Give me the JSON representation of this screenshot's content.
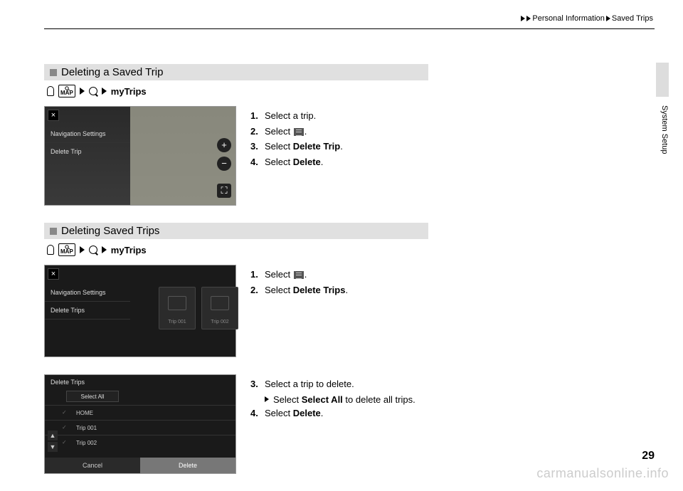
{
  "breadcrumb": {
    "part1": "Personal Information",
    "part2": "Saved Trips"
  },
  "side_tab": "System Setup",
  "page_number": "29",
  "watermark": "carmanualsonline.info",
  "nav": {
    "map_label": "MAP",
    "mytrips": "myTrips"
  },
  "section1": {
    "heading": "Deleting a Saved Trip",
    "screenshot": {
      "menu1": "Navigation Settings",
      "menu2": "Delete Trip"
    },
    "steps": {
      "s1": "Select a trip.",
      "s2a": "Select ",
      "s2b": ".",
      "s3a": "Select ",
      "s3b": "Delete Trip",
      "s3c": ".",
      "s4a": "Select ",
      "s4b": "Delete",
      "s4c": "."
    }
  },
  "section2": {
    "heading": "Deleting Saved Trips",
    "screenshot1": {
      "menu1": "Navigation Settings",
      "menu2": "Delete Trips",
      "card1": "Trip 001",
      "card2": "Trip 002"
    },
    "steps_a": {
      "s1a": "Select ",
      "s1b": ".",
      "s2a": "Select ",
      "s2b": "Delete Trips",
      "s2c": "."
    },
    "screenshot2": {
      "title": "Delete Trips",
      "select_all": "Select All",
      "row1": "HOME",
      "row2": "Trip 001",
      "row3": "Trip 002",
      "cancel": "Cancel",
      "delete": "Delete"
    },
    "steps_b": {
      "s3": "Select a trip to delete.",
      "sub_a": "Select ",
      "sub_b": "Select All",
      "sub_c": " to delete all trips.",
      "s4a": "Select ",
      "s4b": "Delete",
      "s4c": "."
    }
  }
}
